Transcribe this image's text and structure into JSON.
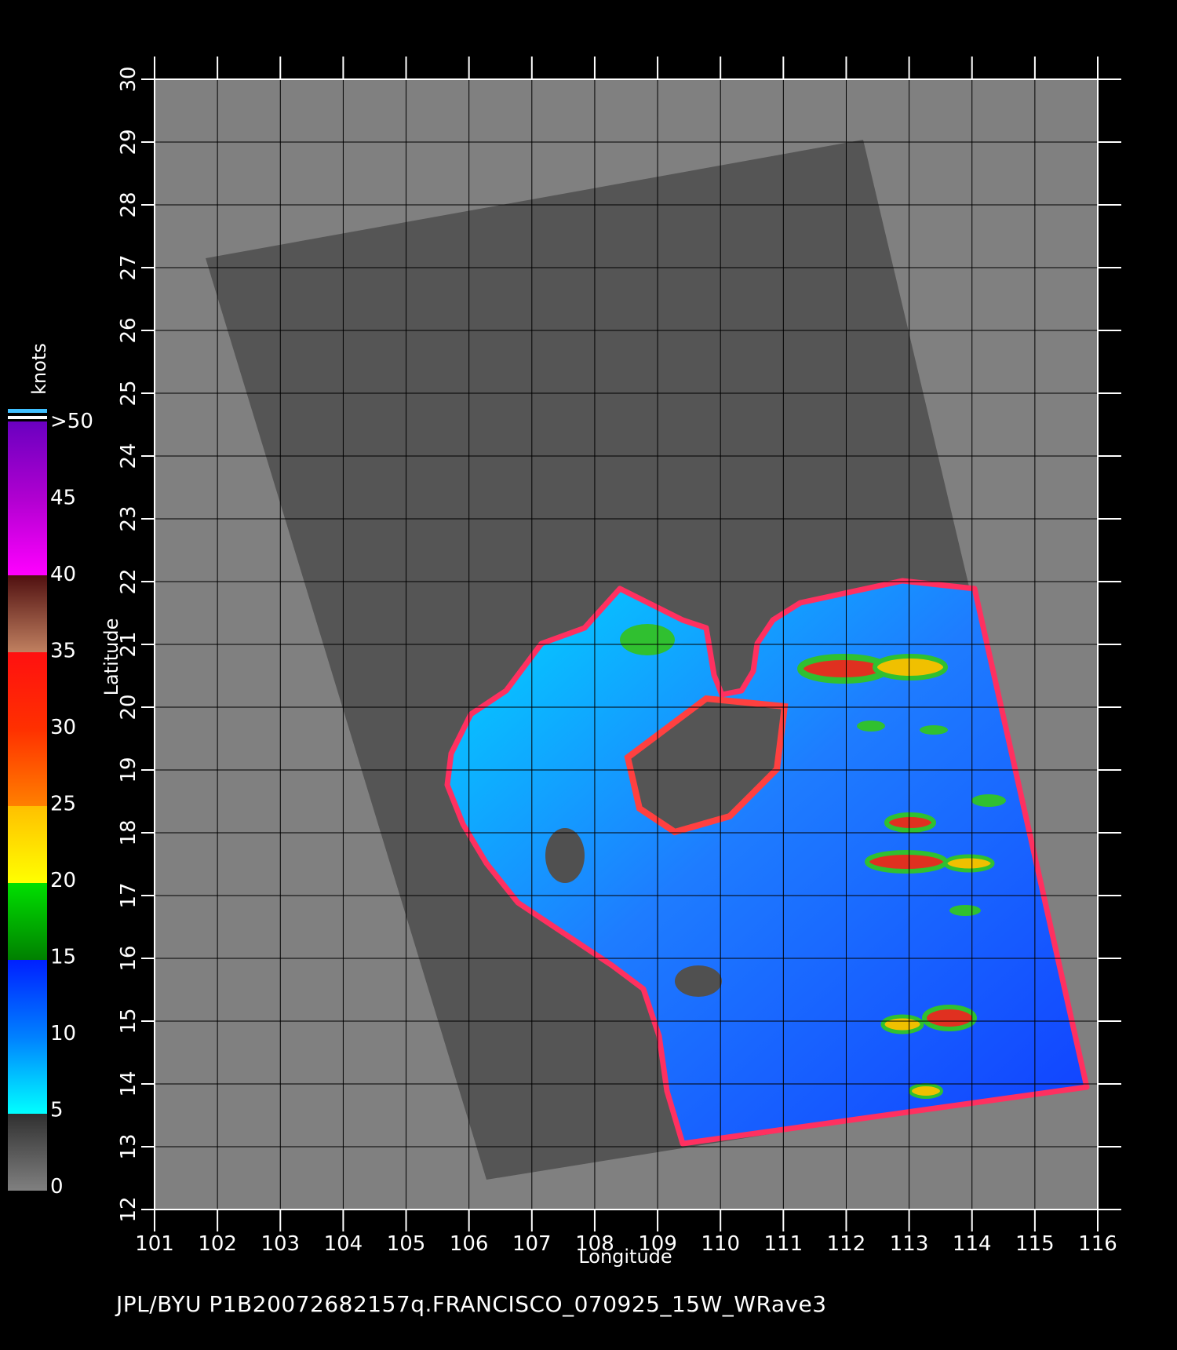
{
  "colorbar": {
    "title": "knots",
    "labels": [
      ">50",
      "45",
      "40",
      "35",
      "30",
      "25",
      "20",
      "15",
      "10",
      "5",
      "0"
    ]
  },
  "axes": {
    "xlabel": "Longitude",
    "ylabel": "Latitude",
    "x_ticks": [
      "101",
      "102",
      "103",
      "104",
      "105",
      "106",
      "107",
      "108",
      "109",
      "110",
      "111",
      "112",
      "113",
      "114",
      "115",
      "116"
    ],
    "y_ticks": [
      "12",
      "13",
      "14",
      "15",
      "16",
      "17",
      "18",
      "19",
      "20",
      "21",
      "22",
      "23",
      "24",
      "25",
      "26",
      "27",
      "28",
      "29",
      "30"
    ]
  },
  "footer": {
    "text": "JPL/BYU  P1B20072682157q.FRANCISCO_070925_15W_WRave3"
  },
  "colors": {
    "background": "#000000",
    "land": "#808080",
    "swath": "#555555",
    "grid": "#000000"
  }
}
